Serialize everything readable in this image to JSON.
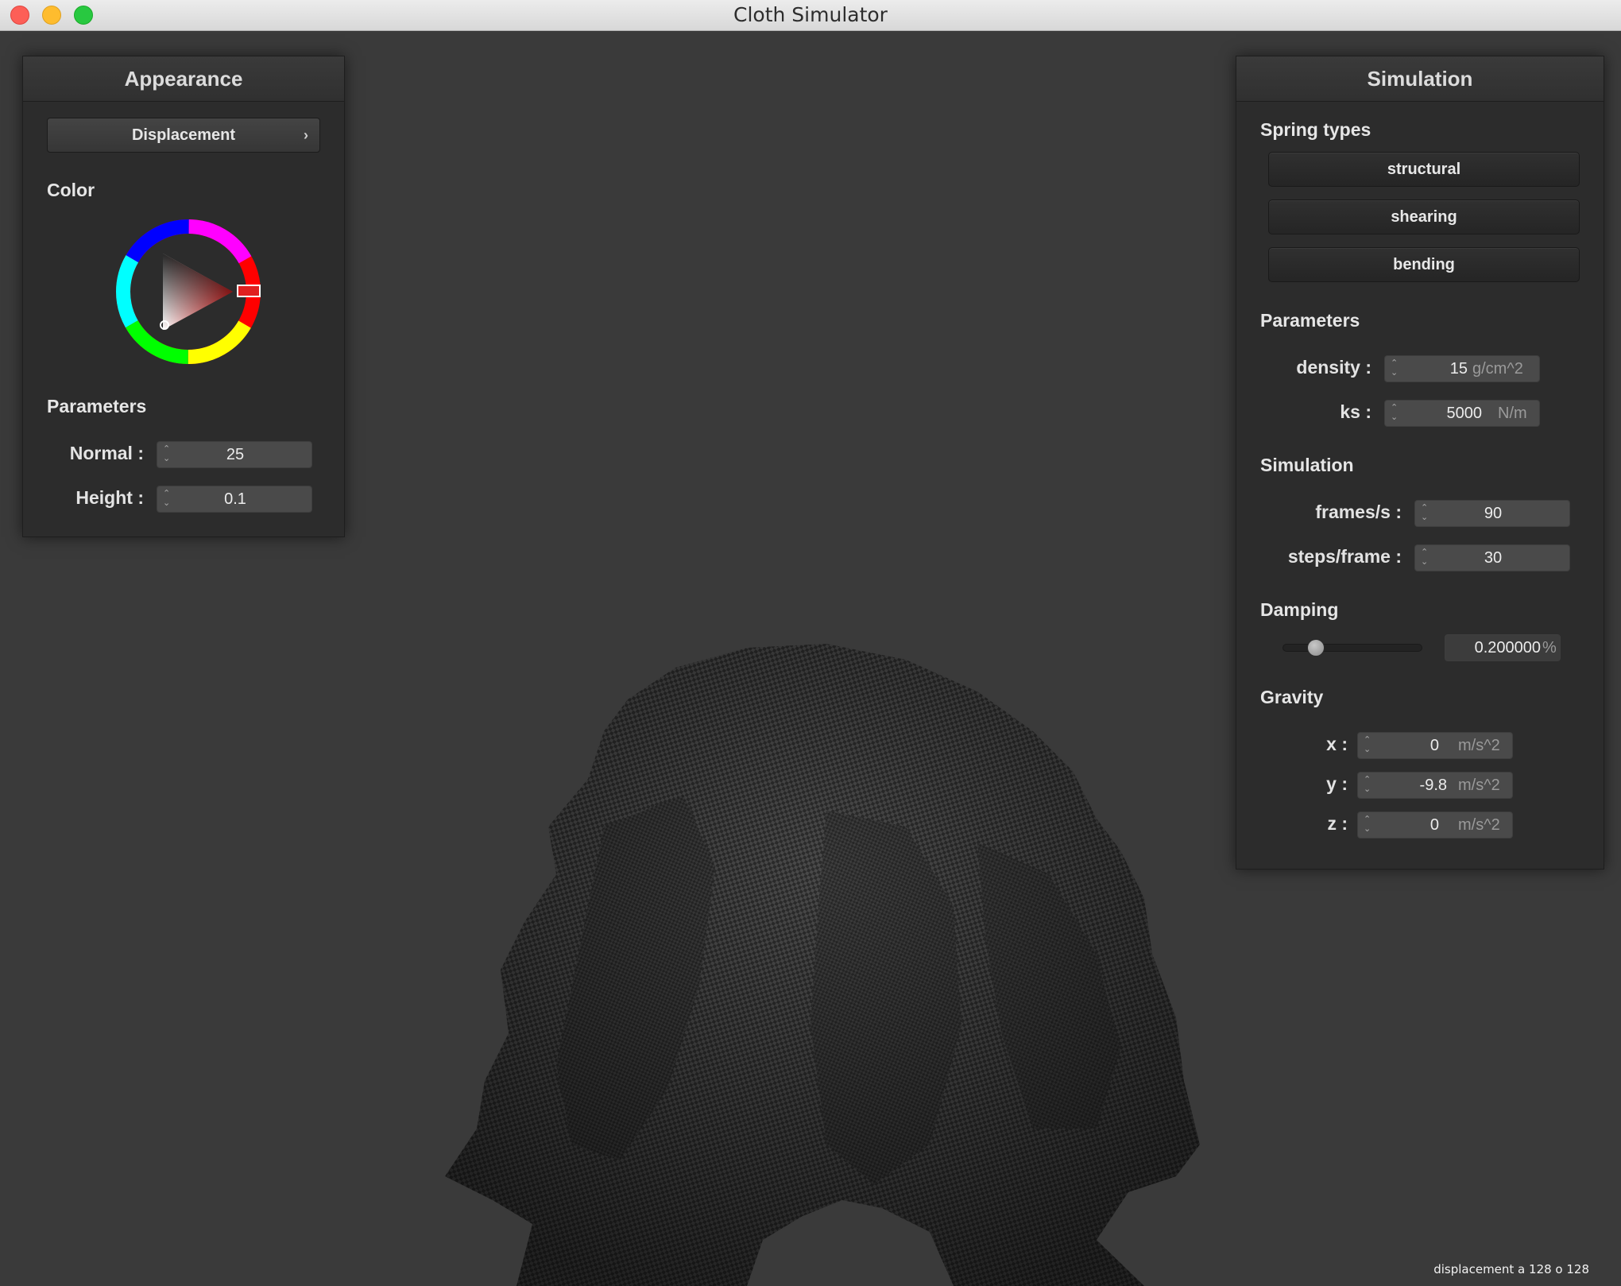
{
  "window": {
    "title": "Cloth Simulator"
  },
  "status_text": "displacement a 128 o 128",
  "appearance": {
    "title": "Appearance",
    "shader": "Displacement",
    "color_label": "Color",
    "selected_color": "#e02020",
    "parameters_label": "Parameters",
    "normal": {
      "label": "Normal :",
      "value": "25"
    },
    "height": {
      "label": "Height :",
      "value": "0.1"
    }
  },
  "simulation": {
    "title": "Simulation",
    "spring_types_label": "Spring types",
    "spring_types": [
      "structural",
      "shearing",
      "bending"
    ],
    "parameters_label": "Parameters",
    "density": {
      "label": "density :",
      "value": "15",
      "unit": "g/cm^2"
    },
    "ks": {
      "label": "ks :",
      "value": "5000",
      "unit": "N/m"
    },
    "simulation_label": "Simulation",
    "fps": {
      "label": "frames/s :",
      "value": "90"
    },
    "steps": {
      "label": "steps/frame :",
      "value": "30"
    },
    "damping_label": "Damping",
    "damping": {
      "value": "0.200000",
      "unit": "%",
      "slider_fraction": 0.2
    },
    "gravity_label": "Gravity",
    "gravity": [
      {
        "label": "x :",
        "value": "0",
        "unit": "m/s^2"
      },
      {
        "label": "y :",
        "value": "-9.8",
        "unit": "m/s^2"
      },
      {
        "label": "z :",
        "value": "0",
        "unit": "m/s^2"
      }
    ]
  }
}
